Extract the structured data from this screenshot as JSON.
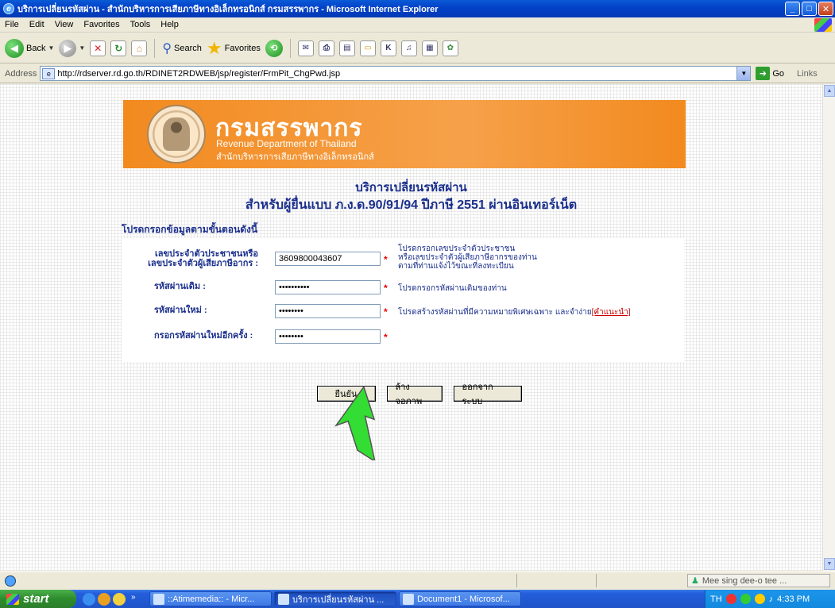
{
  "window": {
    "title": "บริการเปลี่ยนรหัสผ่าน - สำนักบริหารการเสียภาษีทางอิเล็กทรอนิกส์ กรมสรรพากร - Microsoft Internet Explorer"
  },
  "menu": [
    "File",
    "Edit",
    "View",
    "Favorites",
    "Tools",
    "Help"
  ],
  "toolbar": {
    "back_label": "Back",
    "search_label": "Search",
    "favorites_label": "Favorites"
  },
  "address": {
    "label": "Address",
    "url": "http://rdserver.rd.go.th/RDINET2RDWEB/jsp/register/FrmPit_ChgPwd.jsp",
    "go_label": "Go",
    "links_label": "Links"
  },
  "banner": {
    "title_th": "กรมสรรพากร",
    "title_en": "Revenue Department of Thailand",
    "subtitle_th": "สำนักบริหารการเสียภาษีทางอิเล็กทรอนิกส์"
  },
  "page": {
    "heading1": "บริการเปลี่ยนรหัสผ่าน",
    "heading2": "สำหรับผู้ยื่นแบบ ภ.ง.ด.90/91/94 ปีภาษี 2551 ผ่านอินเทอร์เน็ต",
    "instruction": "โปรดกรอกข้อมูลตามขั้นตอนดังนี้"
  },
  "form": {
    "id_label_line1": "เลขประจำตัวประชาชนหรือ",
    "id_label_line2": "เลขประจำตัวผู้เสียภาษีอากร :",
    "id_value": "3609800043607",
    "id_hint_line1": "โปรดกรอกเลขประจำตัวประชาชน",
    "id_hint_line2": "หรือเลขประจำตัวผู้เสียภาษีอากรของท่าน",
    "id_hint_line3": "ตามที่ท่านแจ้งไว้ขณะที่ลงทะเบียน",
    "old_pwd_label": "รหัสผ่านเดิม :",
    "old_pwd_value": "••••••••••",
    "old_pwd_hint": "โปรดกรอกรหัสผ่านเดิมของท่าน",
    "new_pwd_label": "รหัสผ่านใหม่ :",
    "new_pwd_value": "••••••••",
    "new_pwd_hint": "โปรดสร้างรหัสผ่านที่มีความหมายพิเศษเฉพาะ และจำง่าย",
    "new_pwd_hint_link": "[คำแนะนำ]",
    "confirm_pwd_label": "กรอกรหัสผ่านใหม่อีกครั้ง :",
    "confirm_pwd_value": "••••••••",
    "required_mark": "*"
  },
  "buttons": {
    "confirm": "ยืนยัน",
    "clear": "ล้างจอภาพ",
    "logout": "ออกจากระบบ"
  },
  "statusbar": {
    "zone_text": "Mee sing dee-o tee ..."
  },
  "taskbar": {
    "start_label": "start",
    "tasks": [
      "::Atimemedia:: - Micr...",
      "บริการเปลี่ยนรหัสผ่าน ...",
      "Document1 - Microsof..."
    ],
    "tray_lang": "TH",
    "clock": "4:33 PM"
  },
  "colors": {
    "heading": "#1b2f8c",
    "banner": "#f28a1f",
    "required": "#e00000",
    "pointer_arrow": "#33dd33"
  }
}
